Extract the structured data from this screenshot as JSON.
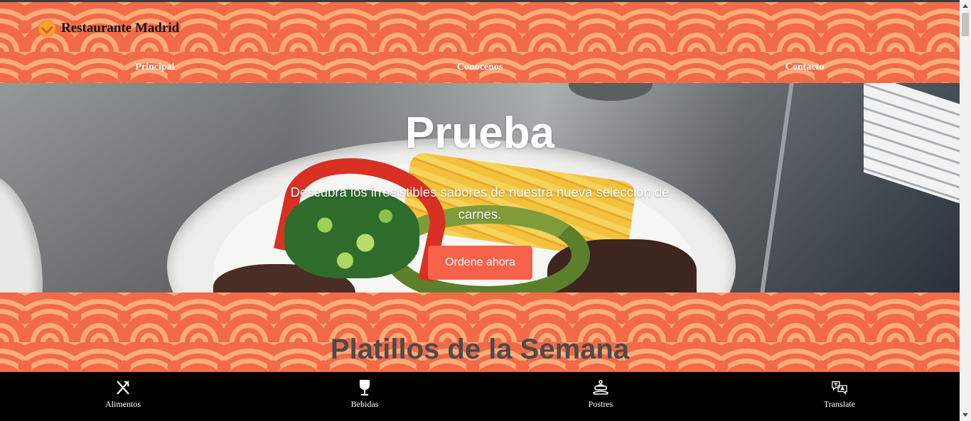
{
  "brand": {
    "name": "Restaurante Madrid",
    "icon": "restaurant-logo-icon"
  },
  "nav": [
    {
      "label": "Principal"
    },
    {
      "label": "Conocenos"
    },
    {
      "label": "Contacto"
    }
  ],
  "hero": {
    "title": "Prueba",
    "subtitle": "Descubra los irresistibles sabores de nuestra nueva seleccion de carnes.",
    "cta": "Ordene ahora"
  },
  "section": {
    "title": "Platillos de la Semana"
  },
  "bottom_nav": [
    {
      "label": "Alimentos",
      "icon": "fork-knife-icon"
    },
    {
      "label": "Bebidas",
      "icon": "wine-glass-icon"
    },
    {
      "label": "Postres",
      "icon": "cake-icon"
    },
    {
      "label": "Translate",
      "icon": "translate-icon"
    }
  ],
  "colors": {
    "accent": "#f7634a",
    "pattern_base": "#f26a47",
    "pattern_light": "#ffab7a",
    "bottom_bar": "#000000"
  }
}
